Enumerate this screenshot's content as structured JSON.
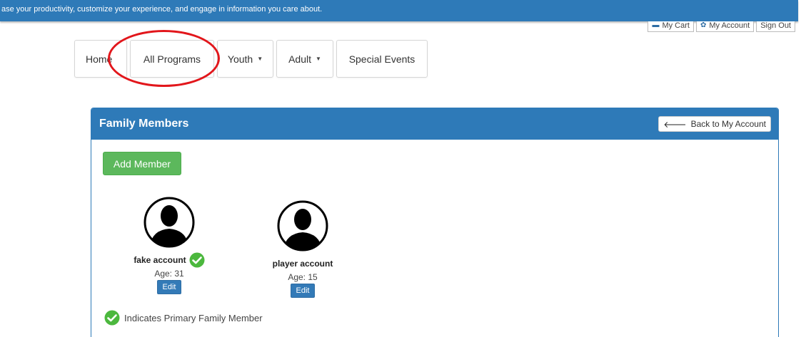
{
  "banner": {
    "text": "ase your productivity, customize your experience, and engage in information you care about."
  },
  "account_bar": {
    "cart_label": "My Cart",
    "account_label": "My Account",
    "signout_label": "Sign Out"
  },
  "nav": {
    "home": "Home",
    "all_programs": "All Programs",
    "youth": "Youth",
    "adult": "Adult",
    "special_events": "Special Events"
  },
  "panel": {
    "title": "Family Members",
    "back_label": "Back to My Account",
    "add_label": "Add Member",
    "members": [
      {
        "name": "fake account",
        "age": "Age: 31",
        "edit": "Edit",
        "primary": true
      },
      {
        "name": "player account",
        "age": "Age: 15",
        "edit": "Edit",
        "primary": false
      }
    ],
    "legend": "Indicates Primary Family Member"
  },
  "colors": {
    "brand_blue": "#2e7ab8",
    "success_green": "#5cb85c",
    "highlight_red": "#e2161b",
    "button_blue": "#337ab7"
  },
  "icons": {
    "cart": "cart-icon",
    "account": "gear-icon",
    "back": "arrow-left-icon",
    "avatar": "user-silhouette-icon",
    "primary": "check-circle-icon"
  }
}
